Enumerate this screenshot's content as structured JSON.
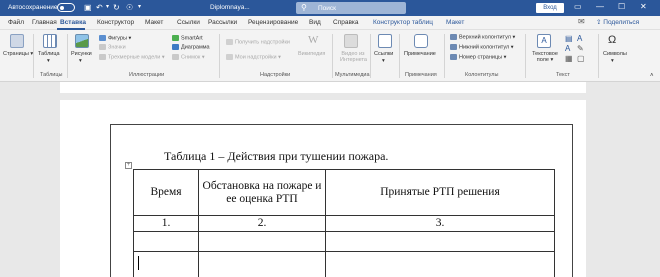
{
  "titlebar": {
    "autosave_label": "Автосохранение",
    "doc_name": "Diplomnaya...",
    "search_label": "Поиск",
    "signin_label": "Вход",
    "accent_color": "#2b579a"
  },
  "menu": {
    "items": [
      "Файл",
      "Главная",
      "Вставка",
      "Конструктор",
      "Макет",
      "Ссылки",
      "Рассылки",
      "Рецензирование",
      "Вид",
      "Справка",
      "Конструктор таблиц",
      "Макет"
    ],
    "active": "Вставка",
    "share_label": "Поделиться"
  },
  "ribbon": {
    "pages_label": "Страницы",
    "table_label": "Таблица",
    "pictures_label": "Рисунки",
    "shapes_label": "Фигуры",
    "icons_label": "Значки",
    "models_label": "Трехмерные модели",
    "smartart_label": "SmartArt",
    "chart_label": "Диаграмма",
    "snapshot_label": "Снимок",
    "get_addins_label": "Получить надстройки",
    "my_addins_label": "Мои надстройки",
    "wiki_label": "Википедия",
    "video_label": "Видео из Интернета",
    "links_label": "Ссылки",
    "comment_label": "Примечание",
    "header_label": "Верхний колонтитул",
    "footer_label": "Нижний колонтитул",
    "pagenum_label": "Номер страницы",
    "textbox_label": "Текстовое поле",
    "symbols_label": "Символы",
    "groups": {
      "tables": "Таблицы",
      "illustrations": "Иллюстрации",
      "addins": "Надстройки",
      "multimedia": "Мультимедиа",
      "comments": "Примечания",
      "headers": "Колонтитулы",
      "text": "Текст"
    }
  },
  "document": {
    "caption": "Таблица 1 – Действия при тушении пожара.",
    "table": {
      "headers": [
        "Время",
        "Обстановка на пожаре и ее оценка РТП",
        "Принятые РТП решения"
      ],
      "numbers": [
        "1.",
        "2.",
        "3."
      ]
    }
  }
}
